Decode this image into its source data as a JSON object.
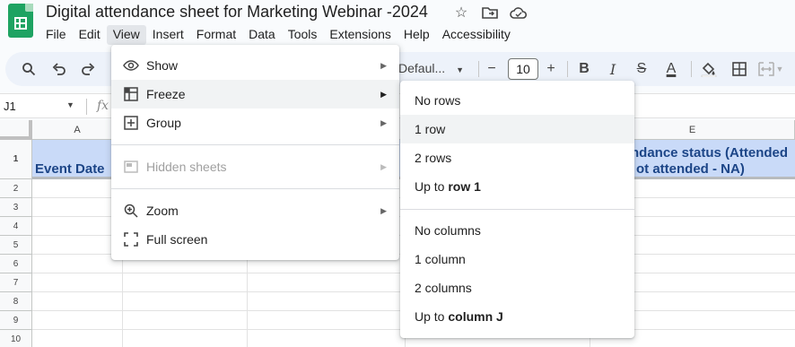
{
  "document": {
    "title": "Digital attendance sheet for Marketing Webinar -2024",
    "title_icons": [
      "star-icon",
      "move-to-folder-icon",
      "cloud-status-icon"
    ]
  },
  "menubar": [
    "File",
    "Edit",
    "View",
    "Insert",
    "Format",
    "Data",
    "Tools",
    "Extensions",
    "Help",
    "Accessibility"
  ],
  "toolbar": {
    "font_name": "Defaul...",
    "font_size": "10",
    "minus": "−",
    "plus": "+",
    "bold": "B",
    "italic": "I",
    "strike": "S",
    "text_color": "A"
  },
  "formula_bar": {
    "name_box": "J1",
    "fx": "fx"
  },
  "columns": [
    "A",
    "E"
  ],
  "rows": [
    "1",
    "2",
    "3",
    "4",
    "5",
    "6",
    "7",
    "8",
    "9",
    "10"
  ],
  "header_cells": {
    "a1": "Event Date",
    "e1_line1": "ndance status (Attended",
    "e1_line2": "ot attended - NA)"
  },
  "view_menu": {
    "items": [
      {
        "label": "Show",
        "icon": "eye-icon"
      },
      {
        "label": "Freeze",
        "icon": "freeze-icon"
      },
      {
        "label": "Group",
        "icon": "group-icon"
      },
      {
        "label": "Hidden sheets",
        "icon": "hidden-sheets-icon"
      },
      {
        "label": "Zoom",
        "icon": "zoom-icon"
      },
      {
        "label": "Full screen",
        "icon": "fullscreen-icon"
      }
    ]
  },
  "freeze_menu": {
    "rows": [
      "No rows",
      "1 row",
      "2 rows"
    ],
    "up_to_row_prefix": "Up to ",
    "up_to_row_target": "row 1",
    "columns": [
      "No columns",
      "1 column",
      "2 columns"
    ],
    "up_to_col_prefix": "Up to ",
    "up_to_col_target": "column J"
  },
  "colors": {
    "header_fill": "#c9daf8",
    "header_text": "#1c4587",
    "sheets_green": "#1ea362"
  }
}
